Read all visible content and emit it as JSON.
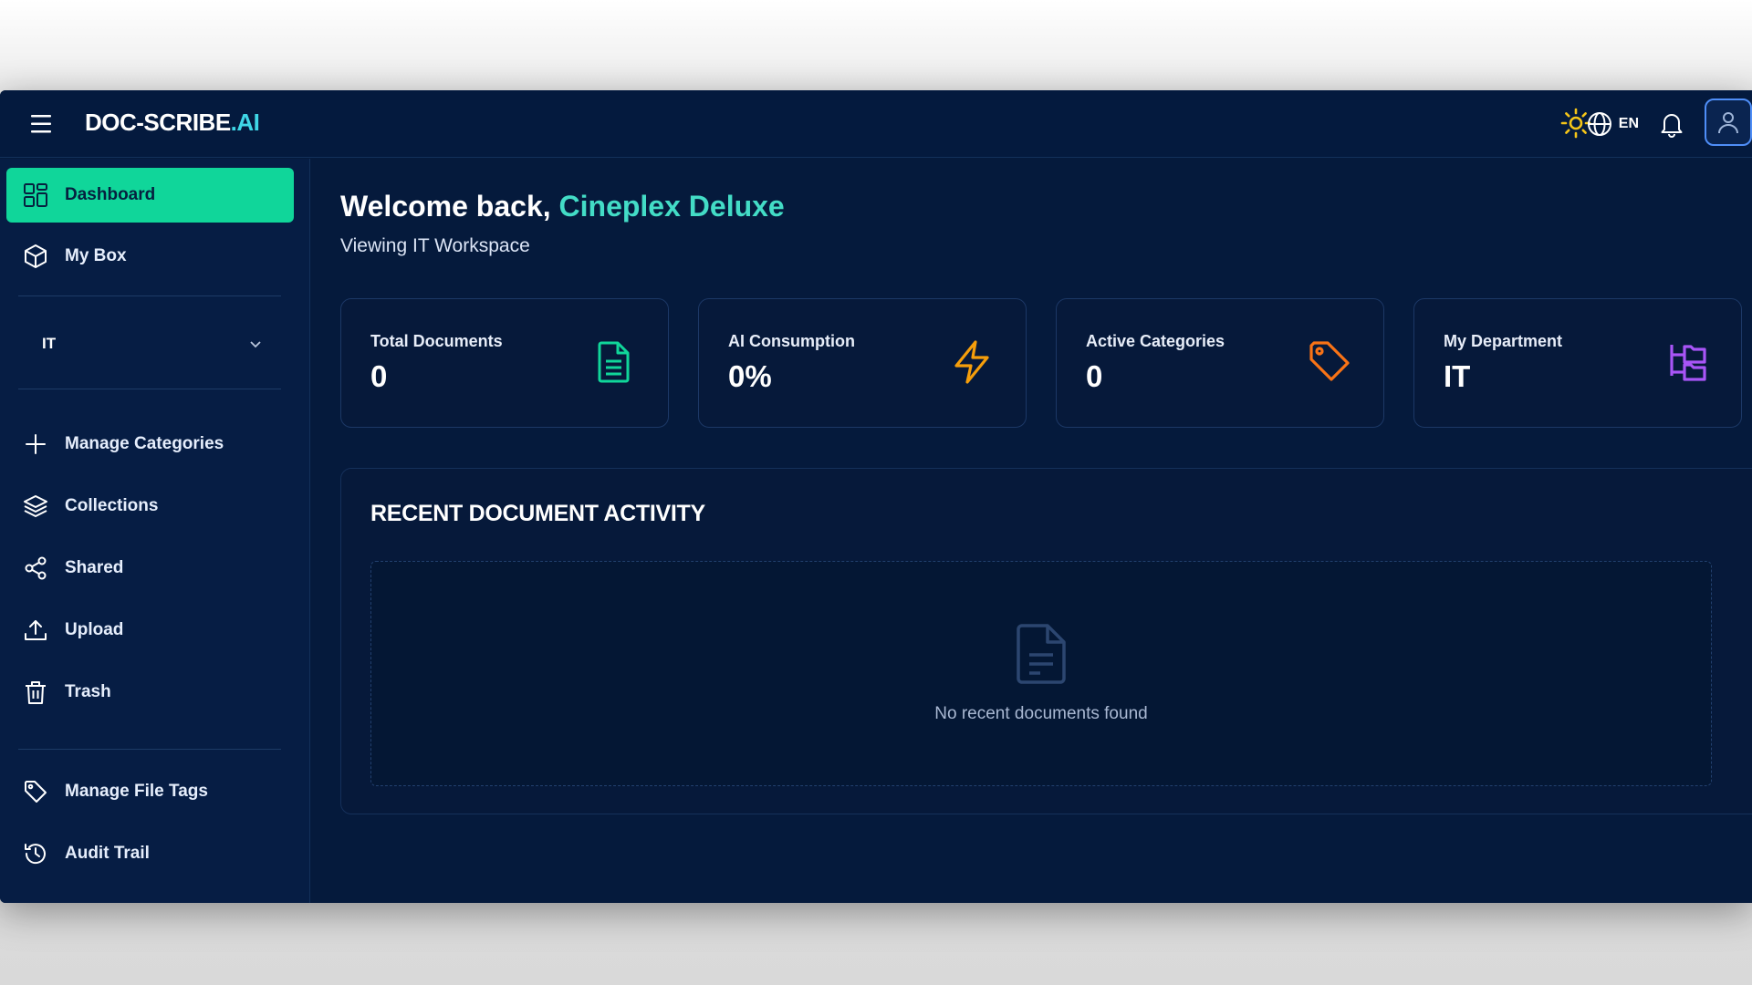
{
  "brand": {
    "name": "DOC-SCRIBE",
    "suffix": ".AI"
  },
  "topbar": {
    "language": "EN"
  },
  "sidebar": {
    "items": [
      {
        "label": "Dashboard",
        "icon": "grid-icon",
        "active": true
      },
      {
        "label": "My Box",
        "icon": "box-icon"
      }
    ],
    "workspace_select": {
      "value": "IT"
    },
    "items2": [
      {
        "label": "Manage Categories",
        "icon": "plus-icon"
      },
      {
        "label": "Collections",
        "icon": "layers-icon"
      },
      {
        "label": "Shared",
        "icon": "share-icon"
      },
      {
        "label": "Upload",
        "icon": "upload-icon"
      },
      {
        "label": "Trash",
        "icon": "trash-icon"
      }
    ],
    "items3": [
      {
        "label": "Manage File Tags",
        "icon": "tag-icon"
      },
      {
        "label": "Audit Trail",
        "icon": "history-icon"
      }
    ]
  },
  "main": {
    "welcome_prefix": "Welcome back,",
    "user_name": "Cineplex Deluxe",
    "subtitle": "Viewing IT Workspace",
    "stats": [
      {
        "label": "Total Documents",
        "value": "0",
        "icon": "document-icon",
        "color": "#10d69a"
      },
      {
        "label": "AI Consumption",
        "value": "0%",
        "icon": "lightning-icon",
        "color": "#f59e0b"
      },
      {
        "label": "Active Categories",
        "value": "0",
        "icon": "tag-icon",
        "color": "#f97316"
      },
      {
        "label": "My Department",
        "value": "IT",
        "icon": "department-tree-icon",
        "color": "#a855f7"
      }
    ],
    "activity": {
      "title": "RECENT DOCUMENT ACTIVITY",
      "empty_text": "No recent documents found"
    }
  },
  "colors": {
    "background": "#051a3c",
    "active_nav": "#10d69a",
    "accent_name": "#43dcc6",
    "brand_accent": "#3fd6e6"
  }
}
